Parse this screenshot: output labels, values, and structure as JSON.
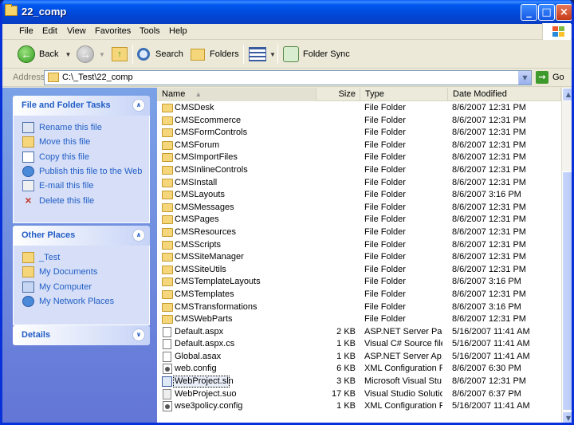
{
  "window": {
    "title": "22_comp"
  },
  "menu": [
    "File",
    "Edit",
    "View",
    "Favorites",
    "Tools",
    "Help"
  ],
  "toolbar": {
    "back_label": "Back",
    "search_label": "Search",
    "folders_label": "Folders",
    "foldersync_label": "Folder Sync"
  },
  "address": {
    "label": "Address",
    "value": "C:\\_Test\\22_comp",
    "go_label": "Go"
  },
  "tasks_panel": {
    "title": "File and Folder Tasks",
    "items": [
      "Rename this file",
      "Move this file",
      "Copy this file",
      "Publish this file to the Web",
      "E-mail this file",
      "Delete this file"
    ]
  },
  "places_panel": {
    "title": "Other Places",
    "items": [
      "_Test",
      "My Documents",
      "My Computer",
      "My Network Places"
    ]
  },
  "details_panel": {
    "title": "Details"
  },
  "columns": {
    "name": "Name",
    "size": "Size",
    "type": "Type",
    "date": "Date Modified"
  },
  "files": [
    {
      "name": "CMSDesk",
      "size": "",
      "type": "File Folder",
      "date": "8/6/2007 12:31 PM",
      "icon": "folder"
    },
    {
      "name": "CMSEcommerce",
      "size": "",
      "type": "File Folder",
      "date": "8/6/2007 12:31 PM",
      "icon": "folder"
    },
    {
      "name": "CMSFormControls",
      "size": "",
      "type": "File Folder",
      "date": "8/6/2007 12:31 PM",
      "icon": "folder"
    },
    {
      "name": "CMSForum",
      "size": "",
      "type": "File Folder",
      "date": "8/6/2007 12:31 PM",
      "icon": "folder"
    },
    {
      "name": "CMSImportFiles",
      "size": "",
      "type": "File Folder",
      "date": "8/6/2007 12:31 PM",
      "icon": "folder"
    },
    {
      "name": "CMSInlineControls",
      "size": "",
      "type": "File Folder",
      "date": "8/6/2007 12:31 PM",
      "icon": "folder"
    },
    {
      "name": "CMSInstall",
      "size": "",
      "type": "File Folder",
      "date": "8/6/2007 12:31 PM",
      "icon": "folder"
    },
    {
      "name": "CMSLayouts",
      "size": "",
      "type": "File Folder",
      "date": "8/6/2007 3:16 PM",
      "icon": "folder"
    },
    {
      "name": "CMSMessages",
      "size": "",
      "type": "File Folder",
      "date": "8/6/2007 12:31 PM",
      "icon": "folder"
    },
    {
      "name": "CMSPages",
      "size": "",
      "type": "File Folder",
      "date": "8/6/2007 12:31 PM",
      "icon": "folder"
    },
    {
      "name": "CMSResources",
      "size": "",
      "type": "File Folder",
      "date": "8/6/2007 12:31 PM",
      "icon": "folder"
    },
    {
      "name": "CMSScripts",
      "size": "",
      "type": "File Folder",
      "date": "8/6/2007 12:31 PM",
      "icon": "folder"
    },
    {
      "name": "CMSSiteManager",
      "size": "",
      "type": "File Folder",
      "date": "8/6/2007 12:31 PM",
      "icon": "folder"
    },
    {
      "name": "CMSSiteUtils",
      "size": "",
      "type": "File Folder",
      "date": "8/6/2007 12:31 PM",
      "icon": "folder"
    },
    {
      "name": "CMSTemplateLayouts",
      "size": "",
      "type": "File Folder",
      "date": "8/6/2007 3:16 PM",
      "icon": "folder"
    },
    {
      "name": "CMSTemplates",
      "size": "",
      "type": "File Folder",
      "date": "8/6/2007 12:31 PM",
      "icon": "folder"
    },
    {
      "name": "CMSTransformations",
      "size": "",
      "type": "File Folder",
      "date": "8/6/2007 3:16 PM",
      "icon": "folder"
    },
    {
      "name": "CMSWebParts",
      "size": "",
      "type": "File Folder",
      "date": "8/6/2007 12:31 PM",
      "icon": "folder"
    },
    {
      "name": "Default.aspx",
      "size": "2 KB",
      "type": "ASP.NET Server Page",
      "date": "5/16/2007 11:41 AM",
      "icon": "doc"
    },
    {
      "name": "Default.aspx.cs",
      "size": "1 KB",
      "type": "Visual C# Source file",
      "date": "5/16/2007 11:41 AM",
      "icon": "doc"
    },
    {
      "name": "Global.asax",
      "size": "1 KB",
      "type": "ASP.NET Server Ap...",
      "date": "5/16/2007 11:41 AM",
      "icon": "doc"
    },
    {
      "name": "web.config",
      "size": "6 KB",
      "type": "XML Configuration File",
      "date": "8/6/2007 6:30 PM",
      "icon": "cfg"
    },
    {
      "name": "WebProject.sln",
      "size": "3 KB",
      "type": "Microsoft Visual Stu...",
      "date": "8/6/2007 12:31 PM",
      "icon": "sln",
      "selected": true
    },
    {
      "name": "WebProject.suo",
      "size": "17 KB",
      "type": "Visual Studio Solutio...",
      "date": "8/6/2007 6:37 PM",
      "icon": "suo"
    },
    {
      "name": "wse3policy.config",
      "size": "1 KB",
      "type": "XML Configuration File",
      "date": "5/16/2007 11:41 AM",
      "icon": "cfg"
    }
  ]
}
